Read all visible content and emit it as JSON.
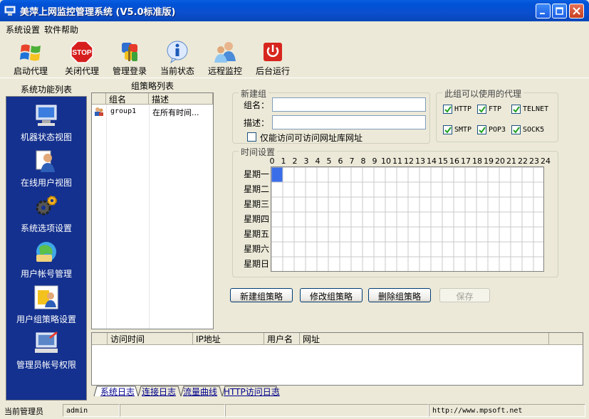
{
  "window": {
    "title": "美萍上网监控管理系统 (V5.0标准版)"
  },
  "menu": [
    "系统设置",
    "软件帮助"
  ],
  "toolbar": [
    {
      "label": "启动代理",
      "icon": "windows-logo-icon"
    },
    {
      "label": "关闭代理",
      "icon": "stop-sign-icon"
    },
    {
      "label": "管理登录",
      "icon": "keys-icon"
    },
    {
      "label": "当前状态",
      "icon": "info-icon"
    },
    {
      "label": "远程监控",
      "icon": "remote-users-icon"
    },
    {
      "label": "后台运行",
      "icon": "power-icon"
    }
  ],
  "sidebar": {
    "title": "系统功能列表",
    "items": [
      {
        "label": "机器状态视图",
        "icon": "computer-icon"
      },
      {
        "label": "在线用户视图",
        "icon": "online-user-icon"
      },
      {
        "label": "系统选项设置",
        "icon": "gears-icon"
      },
      {
        "label": "用户帐号管理",
        "icon": "user-account-icon"
      },
      {
        "label": "用户组策略设置",
        "icon": "group-policy-icon"
      },
      {
        "label": "管理员帐号权限",
        "icon": "admin-permission-icon"
      }
    ]
  },
  "group_list": {
    "title": "组策略列表",
    "columns": [
      "组名",
      "描述"
    ],
    "rows": [
      {
        "name": "group1",
        "desc": "在所有时间..."
      }
    ]
  },
  "new_group": {
    "legend": "新建组",
    "name_label": "组名：",
    "name_value": "",
    "desc_label": "描述：",
    "desc_value": "",
    "restrict_label": "仅能访问可访问网址库网址",
    "restrict_checked": false
  },
  "proxies": {
    "legend": "此组可以使用的代理",
    "items": [
      {
        "label": "HTTP",
        "checked": true
      },
      {
        "label": "FTP",
        "checked": true
      },
      {
        "label": "TELNET",
        "checked": true
      },
      {
        "label": "SMTP",
        "checked": true
      },
      {
        "label": "POP3",
        "checked": true
      },
      {
        "label": "SOCK5",
        "checked": true
      }
    ]
  },
  "time_settings": {
    "legend": "时间设置",
    "hours": [
      "0",
      "1",
      "2",
      "3",
      "4",
      "5",
      "6",
      "7",
      "8",
      "9",
      "10",
      "11",
      "12",
      "13",
      "14",
      "15",
      "16",
      "17",
      "18",
      "19",
      "20",
      "21",
      "22",
      "23",
      "24"
    ],
    "days": [
      "星期一",
      "星期二",
      "星期三",
      "星期四",
      "星期五",
      "星期六",
      "星期日"
    ],
    "selected_cell": {
      "day": 0,
      "hour": 0
    }
  },
  "buttons": {
    "new": "新建组策略",
    "edit": "修改组策略",
    "delete": "删除组策略",
    "save": "保存"
  },
  "log": {
    "columns": [
      "访问时间",
      "IP地址",
      "用户名",
      "网址"
    ],
    "tabs": [
      "系统日志",
      "连接日志",
      "流量曲线",
      "HTTP访问日志"
    ]
  },
  "status": {
    "label": "当前管理员",
    "admin": "admin",
    "url": "http://www.mpsoft.net"
  },
  "colors": {
    "sidebar_bg": "#14318F",
    "selected_cell": "#3A6EE8",
    "titlebar": "#0B4FCF"
  }
}
